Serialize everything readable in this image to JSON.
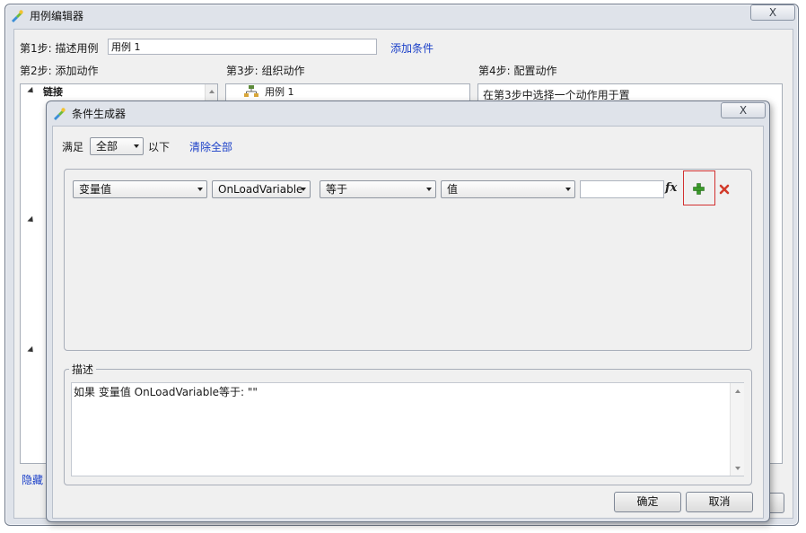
{
  "outer": {
    "title": "用例编辑器",
    "close_label": "X",
    "step1_label": "第1步: 描述用例",
    "case_name": "用例 1",
    "add_condition": "添加条件",
    "step2_label": "第2步: 添加动作",
    "step3_label": "第3步: 组织动作",
    "step4_label": "第4步: 配置动作",
    "actions_tree_first": "链接",
    "case_node": "用例 1",
    "step4_hint": "在第3步中选择一个动作用于置",
    "hide_link": "隐藏"
  },
  "dialog": {
    "title": "条件生成器",
    "close_label": "X",
    "satisfy_label": "满足",
    "match_mode": "全部",
    "below_label": "以下",
    "clear_all": "清除全部",
    "condition_row": {
      "type": "变量值",
      "variable": "OnLoadVariable",
      "operator": "等于",
      "value_type": "值",
      "value": ""
    },
    "fx_label": "fx",
    "description_label": "描述",
    "description_text": "如果 变量值 OnLoadVariable等于: \"\"",
    "ok_label": "确定",
    "cancel_label": "取消"
  },
  "colors": {
    "link": "#1a3fc8",
    "add_green": "#3a9a2a",
    "delete_red": "#d23a2a",
    "highlight_border": "#d23030"
  }
}
